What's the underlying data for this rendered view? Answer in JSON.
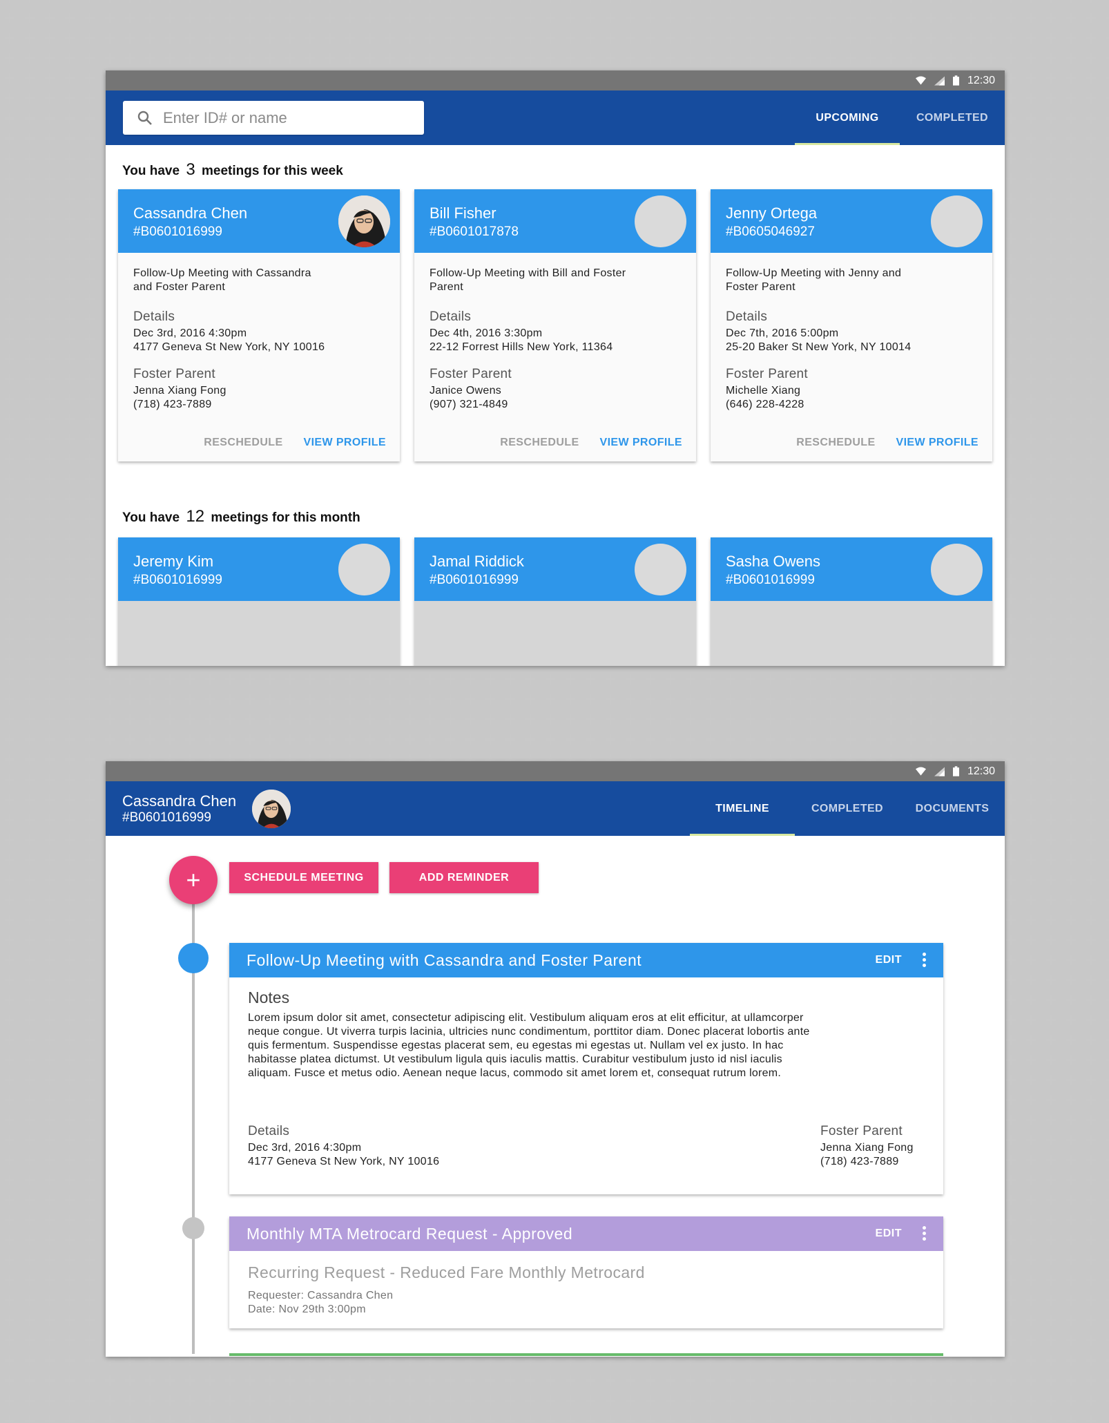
{
  "status": {
    "time": "12:30"
  },
  "screen1": {
    "search": {
      "placeholder": "Enter ID# or name"
    },
    "tabs": [
      "UPCOMING",
      "COMPLETED"
    ],
    "week": {
      "prefix": "You have",
      "count": "3",
      "suffix": "meetings for this week"
    },
    "month": {
      "prefix": "You have",
      "count": "12",
      "suffix": "meetings for this month"
    },
    "weekCards": [
      {
        "name": "Cassandra Chen",
        "id": "#B0601016999",
        "meeting1": "Follow-Up Meeting with Cassandra",
        "meeting2": "and Foster Parent",
        "detailsLabel": "Details",
        "date": "Dec 3rd, 2016 4:30pm",
        "address": "4177 Geneva St  New York, NY 10016",
        "fosterLabel": "Foster Parent",
        "fosterName": "Jenna Xiang Fong",
        "fosterPhone": "(718) 423-7889",
        "reschedule": "RESCHEDULE",
        "viewProfile": "VIEW PROFILE"
      },
      {
        "name": "Bill Fisher",
        "id": "#B0601017878",
        "meeting1": "Follow-Up Meeting with Bill and Foster",
        "meeting2": "Parent",
        "detailsLabel": "Details",
        "date": "Dec 4th, 2016 3:30pm",
        "address": "22-12 Forrest Hills New York, 11364",
        "fosterLabel": "Foster Parent",
        "fosterName": "Janice Owens",
        "fosterPhone": "(907) 321-4849",
        "reschedule": "RESCHEDULE",
        "viewProfile": "VIEW PROFILE"
      },
      {
        "name": "Jenny Ortega",
        "id": "#B0605046927",
        "meeting1": "Follow-Up Meeting with Jenny and",
        "meeting2": "Foster Parent",
        "detailsLabel": "Details",
        "date": "Dec 7th, 2016 5:00pm",
        "address": "25-20 Baker St  New York, NY 10014",
        "fosterLabel": "Foster Parent",
        "fosterName": "Michelle Xiang",
        "fosterPhone": "(646) 228-4228",
        "reschedule": "RESCHEDULE",
        "viewProfile": "VIEW PROFILE"
      }
    ],
    "monthCards": [
      {
        "name": "Jeremy Kim",
        "id": "#B0601016999"
      },
      {
        "name": "Jamal Riddick",
        "id": "#B0601016999"
      },
      {
        "name": "Sasha Owens",
        "id": "#B0601016999"
      }
    ]
  },
  "screen2": {
    "profile": {
      "name": "Cassandra Chen",
      "id": "#B0601016999"
    },
    "tabs": [
      "TIMELINE",
      "COMPLETED",
      "DOCUMENTS"
    ],
    "fab": "+",
    "actions": {
      "schedule": "SCHEDULE MEETING",
      "reminder": "ADD REMINDER"
    },
    "meeting": {
      "title": "Follow-Up Meeting with Cassandra and Foster Parent",
      "edit": "EDIT",
      "notesLabel": "Notes",
      "notes": [
        "Lorem ipsum dolor sit amet, consectetur adipiscing elit. Vestibulum aliquam eros at elit efficitur, at ullamcorper",
        "neque congue. Ut viverra turpis lacinia, ultricies nunc condimentum, porttitor diam. Donec placerat lobortis ante",
        "quis fermentum. Suspendisse egestas placerat sem, eu egestas mi egestas ut. Nullam vel ex justo. In hac",
        "habitasse platea dictumst. Ut vestibulum ligula quis iaculis mattis. Curabitur vestibulum justo id nisl iaculis",
        "aliquam. Fusce et metus odio. Aenean neque lacus, commodo sit amet lorem et, consequat rutrum lorem."
      ],
      "detailsLabel": "Details",
      "date": "Dec 3rd, 2016 4:30pm",
      "address": "4177 Geneva St  New York, NY 10016",
      "fosterLabel": "Foster Parent",
      "fosterName": "Jenna Xiang Fong",
      "fosterPhone": "(718) 423-7889"
    },
    "request": {
      "title": "Monthly MTA Metrocard Request - Approved",
      "edit": "EDIT",
      "subtitle": "Recurring Request - Reduced Fare Monthly Metrocard",
      "requester": "Requester: Cassandra Chen",
      "date": "Date: Nov 29th 3:00pm"
    }
  },
  "colors": {
    "appbar": "#164c9e",
    "cardHead": "#2e96ea",
    "accentPink": "#ea3f76",
    "purple": "#b39ddb",
    "statusbar": "#757575",
    "tabIndicator": "#d7e8a0"
  }
}
